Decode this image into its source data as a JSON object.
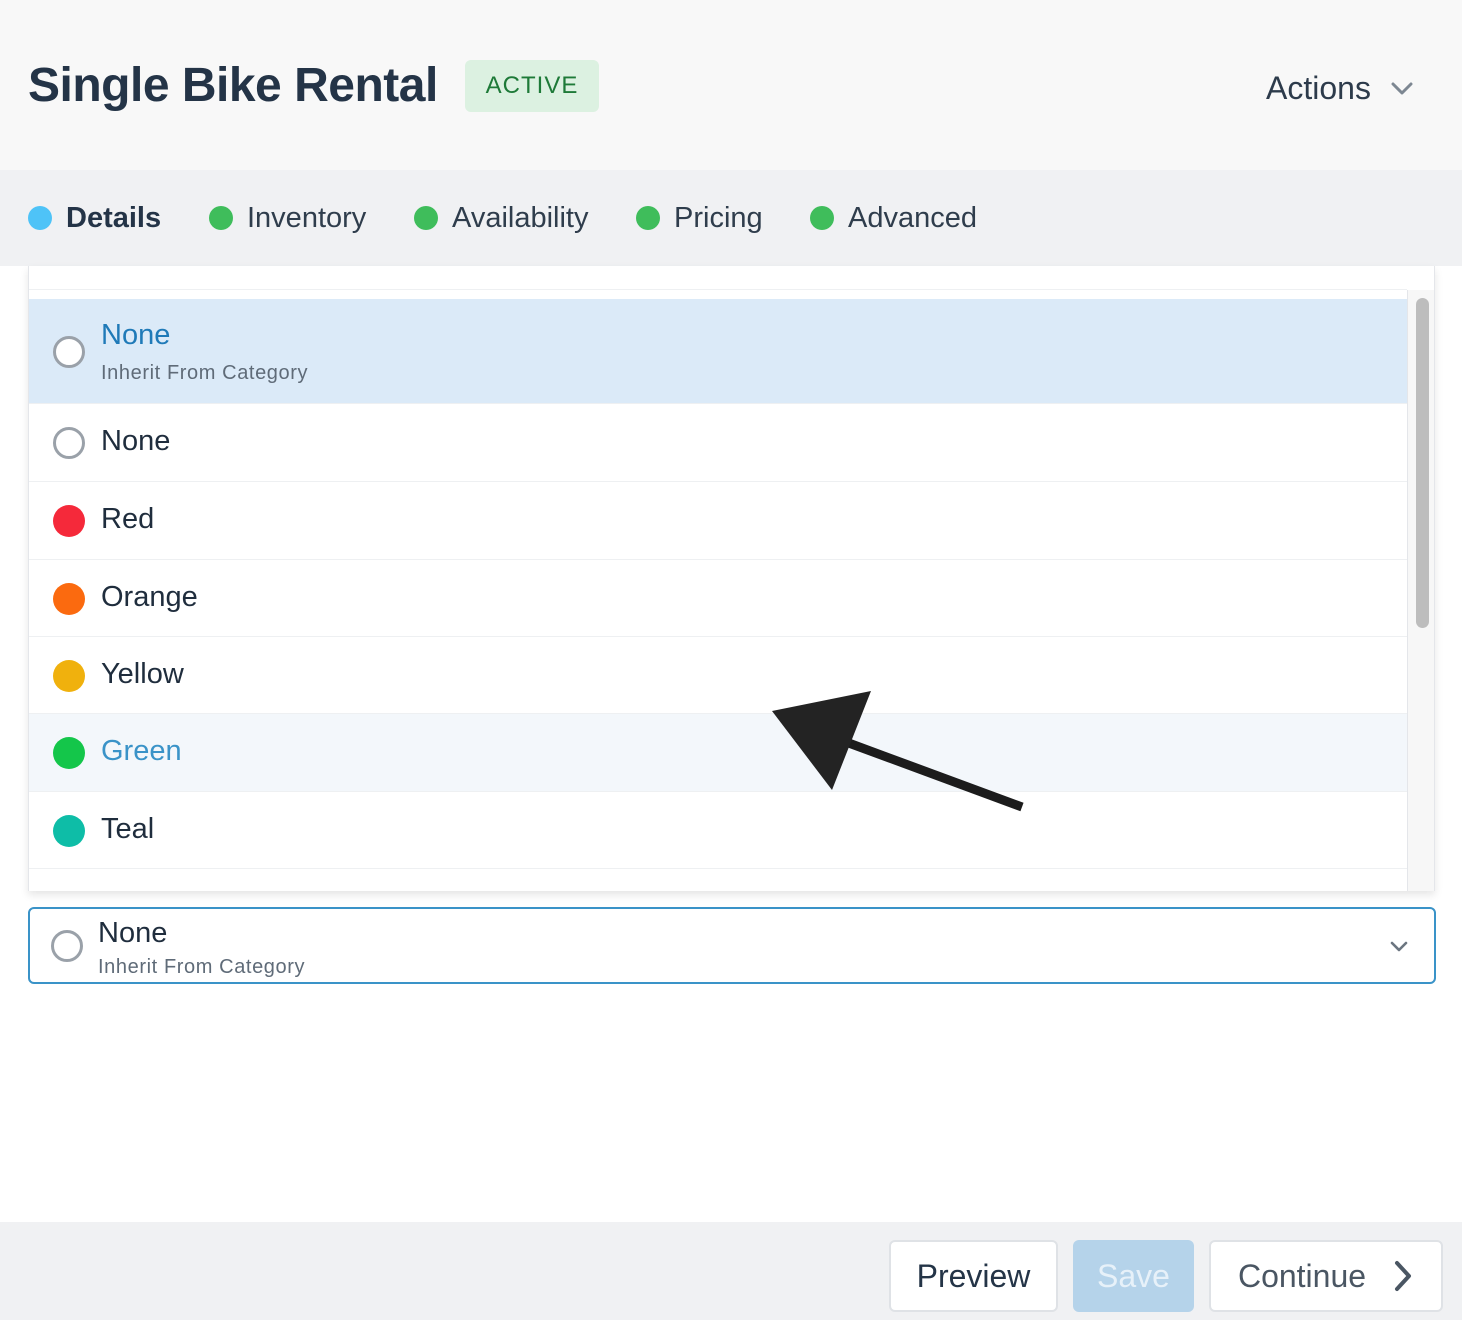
{
  "header": {
    "title": "Single Bike Rental",
    "status_badge": "ACTIVE",
    "actions_label": "Actions"
  },
  "tabs": [
    {
      "label": "Details",
      "color": "#4ec3f7",
      "active": true
    },
    {
      "label": "Inventory",
      "color": "#3fbd5b",
      "active": false
    },
    {
      "label": "Availability",
      "color": "#3fbd5b",
      "active": false
    },
    {
      "label": "Pricing",
      "color": "#3fbd5b",
      "active": false
    },
    {
      "label": "Advanced",
      "color": "#3fbd5b",
      "active": false
    }
  ],
  "color_options": [
    {
      "label": "None",
      "sublabel": "Inherit From Category",
      "swatch": "ring",
      "state": "selected"
    },
    {
      "label": "None",
      "sublabel": "",
      "swatch": "ring",
      "state": "normal"
    },
    {
      "label": "Red",
      "sublabel": "",
      "swatch": "#f5293a",
      "state": "normal"
    },
    {
      "label": "Orange",
      "sublabel": "",
      "swatch": "#fb6a0f",
      "state": "normal"
    },
    {
      "label": "Yellow",
      "sublabel": "",
      "swatch": "#f0b10d",
      "state": "normal"
    },
    {
      "label": "Green",
      "sublabel": "",
      "swatch": "#14c64a",
      "state": "hover"
    },
    {
      "label": "Teal",
      "sublabel": "",
      "swatch": "#0ebda7",
      "state": "normal"
    }
  ],
  "select": {
    "label": "None",
    "sublabel": "Inherit From Category"
  },
  "footer": {
    "preview_label": "Preview",
    "save_label": "Save",
    "continue_label": "Continue"
  },
  "colors": {
    "selected_row_bg": "#dbeaf8",
    "hover_row_bg": "#f3f7fb",
    "selected_text": "#1f7ab8",
    "hover_text": "#3a93c8",
    "focus_border": "#3a93c8"
  }
}
